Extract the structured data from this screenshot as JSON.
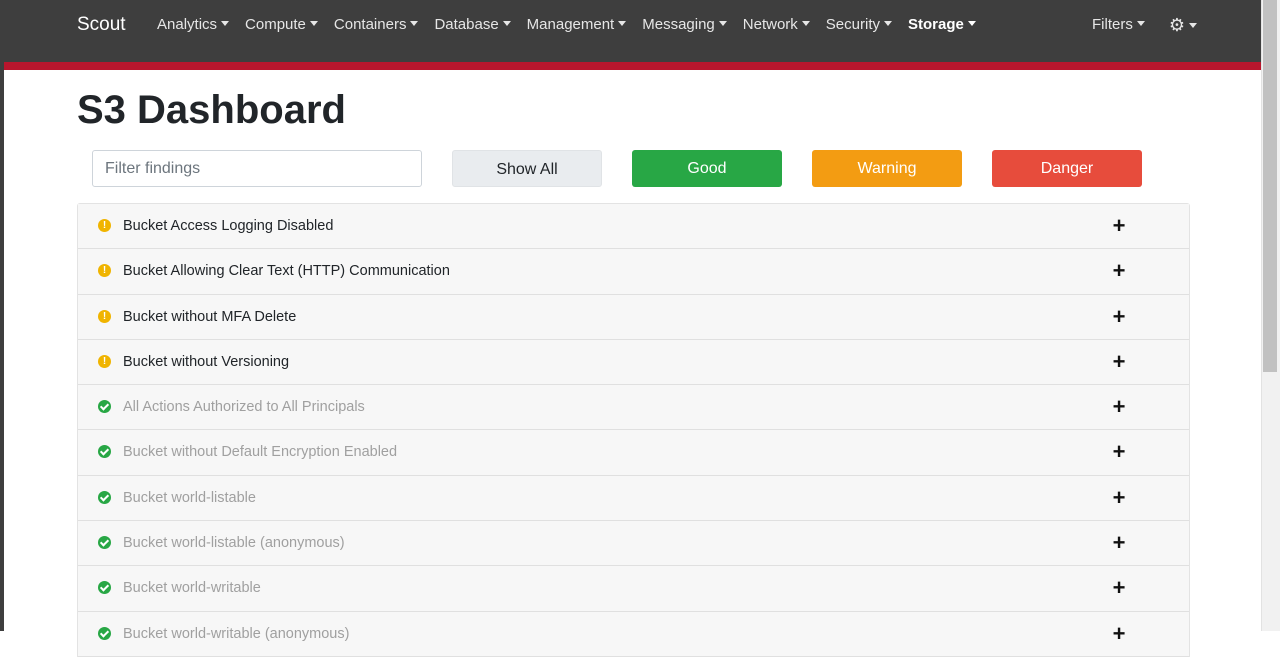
{
  "app": {
    "brand": "Scout"
  },
  "nav": {
    "items": [
      {
        "label": "Analytics",
        "active": false
      },
      {
        "label": "Compute",
        "active": false
      },
      {
        "label": "Containers",
        "active": false
      },
      {
        "label": "Database",
        "active": false
      },
      {
        "label": "Management",
        "active": false
      },
      {
        "label": "Messaging",
        "active": false
      },
      {
        "label": "Network",
        "active": false
      },
      {
        "label": "Security",
        "active": false
      },
      {
        "label": "Storage",
        "active": true
      }
    ],
    "filters_label": "Filters",
    "settings_icon": "gear-icon"
  },
  "page": {
    "title": "S3 Dashboard"
  },
  "filter": {
    "placeholder": "Filter findings",
    "value": "",
    "buttons": {
      "show_all": "Show All",
      "good": "Good",
      "warning": "Warning",
      "danger": "Danger"
    }
  },
  "colors": {
    "navbar": "#3e3e3e",
    "accent_stripe": "#b8162d",
    "good": "#28a745",
    "warning": "#f39c12",
    "danger": "#e74c3c"
  },
  "findings": [
    {
      "status": "warning",
      "label": "Bucket Access Logging Disabled"
    },
    {
      "status": "warning",
      "label": "Bucket Allowing Clear Text (HTTP) Communication"
    },
    {
      "status": "warning",
      "label": "Bucket without MFA Delete"
    },
    {
      "status": "warning",
      "label": "Bucket without Versioning"
    },
    {
      "status": "good",
      "label": "All Actions Authorized to All Principals"
    },
    {
      "status": "good",
      "label": "Bucket without Default Encryption Enabled"
    },
    {
      "status": "good",
      "label": "Bucket world-listable"
    },
    {
      "status": "good",
      "label": "Bucket world-listable (anonymous)"
    },
    {
      "status": "good",
      "label": "Bucket world-writable"
    },
    {
      "status": "good",
      "label": "Bucket world-writable (anonymous)"
    }
  ]
}
